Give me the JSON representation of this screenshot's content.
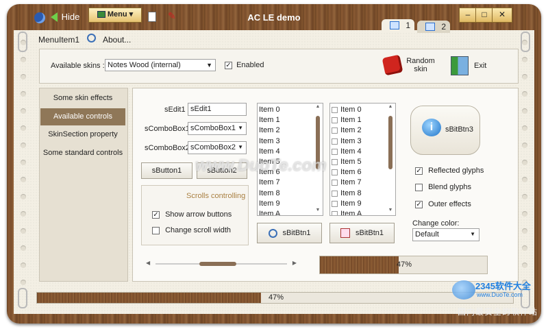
{
  "window": {
    "title": "AC LE demo",
    "hide_label": "Hide",
    "menu_label": "Menu"
  },
  "tabs": [
    {
      "label": "1"
    },
    {
      "label": "2"
    }
  ],
  "menubar": {
    "item1": "MenuItem1",
    "about": "About..."
  },
  "top": {
    "skins_label": "Available skins :",
    "skin_value": "Notes Wood (internal)",
    "enabled_label": "Enabled",
    "random_label": "Random skin",
    "exit_label": "Exit"
  },
  "nav": [
    {
      "label": "Some skin effects"
    },
    {
      "label": "Available controls"
    },
    {
      "label": "SkinSection property"
    },
    {
      "label": "Some standard controls"
    }
  ],
  "form": {
    "sedit_label": "sEdit1",
    "sedit_value": "sEdit1",
    "combo1_label": "sComboBox1",
    "combo1_value": "sComboBox1",
    "combo2_label": "sComboBox2",
    "combo2_value": "sComboBox2",
    "button1": "sButton1",
    "button2": "sButton2"
  },
  "scrolls": {
    "title": "Scrolls controlling",
    "opt1": "Show arrow buttons",
    "opt2": "Change scroll width"
  },
  "list1": [
    "Item 0",
    "Item 1",
    "Item 2",
    "Item 3",
    "Item 4",
    "Item 5",
    "Item 6",
    "Item 7",
    "Item 8",
    "Item 9",
    "Item A"
  ],
  "list2": [
    "Item 0",
    "Item 1",
    "Item 2",
    "Item 3",
    "Item 4",
    "Item 5",
    "Item 6",
    "Item 7",
    "Item 8",
    "Item 9",
    "Item A"
  ],
  "bitbtns": {
    "btn1": "sBitBtn1",
    "btn2": "sBitBtn1",
    "btn3": "sBitBtn3"
  },
  "options": {
    "reflected": "Reflected glyphs",
    "blend": "Blend glyphs",
    "outer": "Outer effects",
    "color_label": "Change color:",
    "color_value": "Default"
  },
  "progress": {
    "inner_label": "47%",
    "inner_value": 0.47,
    "bottom_label": "47%",
    "bottom_value": 0.47
  },
  "watermark": {
    "text": "www.DuoTe.com",
    "brand": "2345软件大全",
    "brand_url": "www.DuoTe.com",
    "footer": "国内最安全的软件站"
  }
}
